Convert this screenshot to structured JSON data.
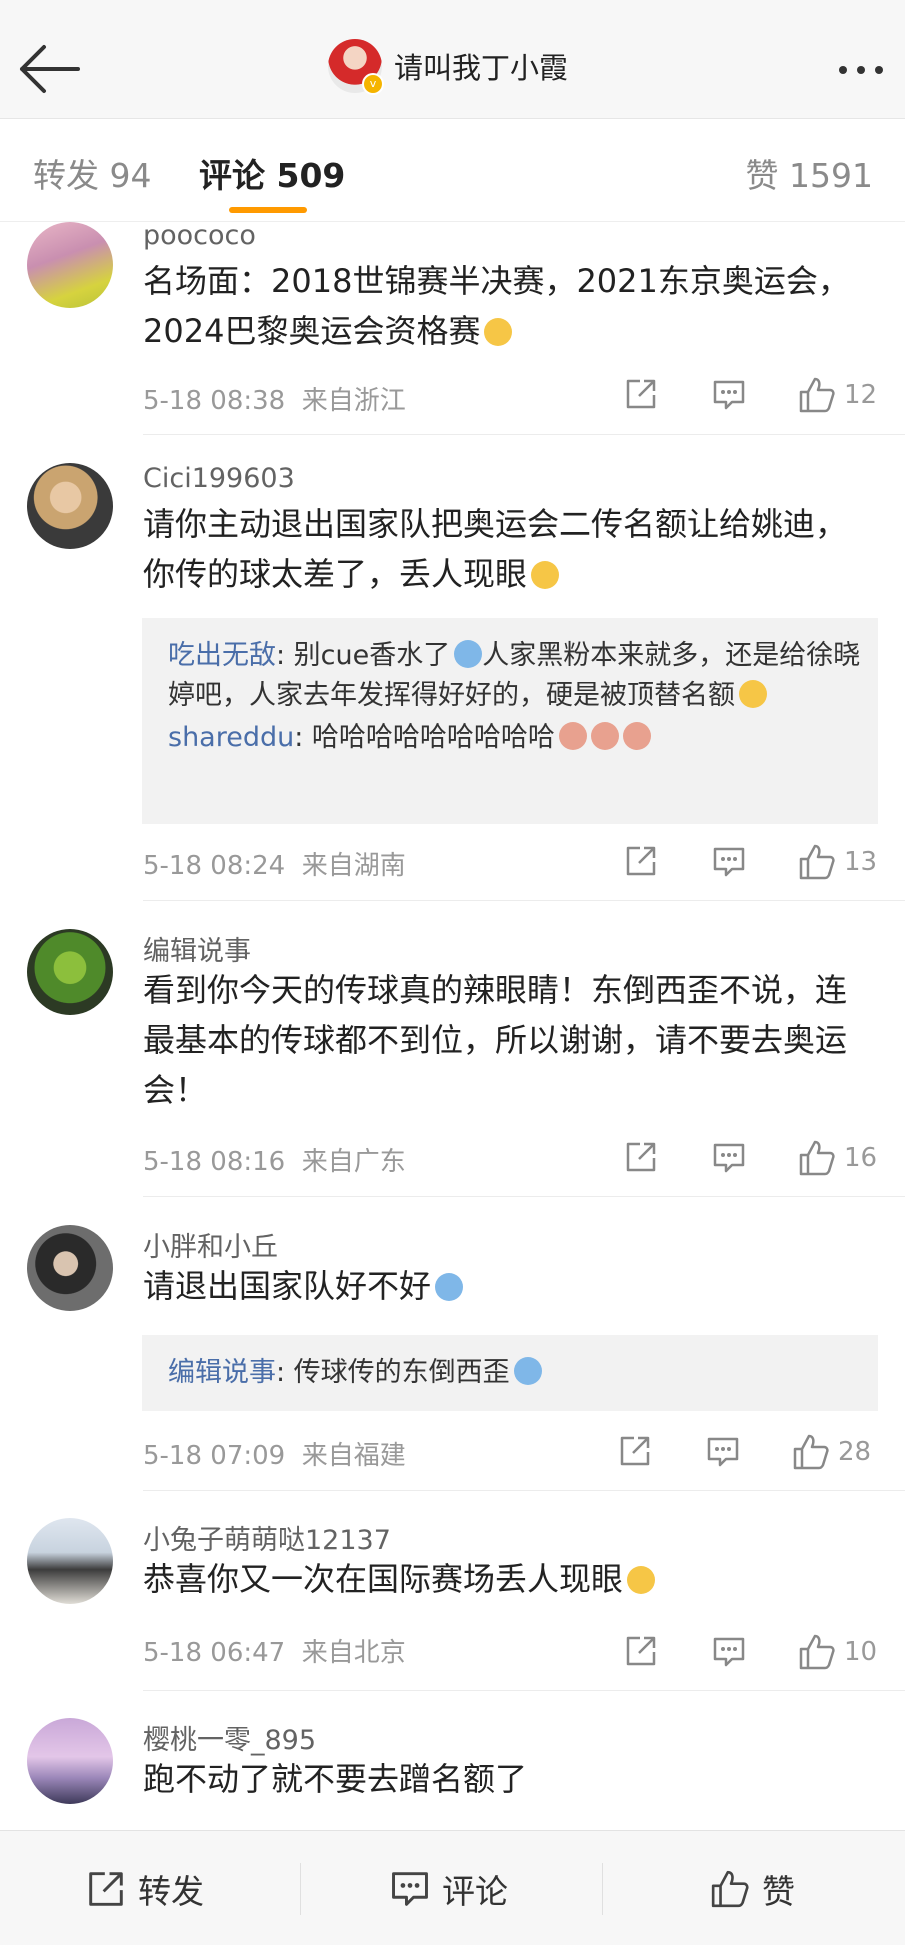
{
  "header": {
    "title": "请叫我丁小霞"
  },
  "tabs": {
    "repost": "转发 94",
    "comment": "评论 509",
    "like": "赞 1591"
  },
  "comments": [
    {
      "user": "poococo",
      "text": "名场面：2018世锦赛半决赛，2021东京奥运会，2024巴黎奥运会资格赛",
      "time": "5-18 08:38",
      "location": "来自浙江",
      "likes": "12"
    },
    {
      "user": "Cici199603",
      "text": "请你主动退出国家队把奥运会二传名额让给姚迪，你传的球太差了，丢人现眼",
      "replies": [
        {
          "user": "吃出无敌",
          "text": ": 别cue香水了",
          "text2": "人家黑粉本来就多，还是给徐晓婷吧，人家去年发挥得好好的，硬是被顶替名额"
        },
        {
          "user": "shareddu",
          "text": ": 哈哈哈哈哈哈哈哈哈"
        }
      ],
      "time": "5-18 08:24",
      "location": "来自湖南",
      "likes": "13"
    },
    {
      "user": "编辑说事",
      "text": "看到你今天的传球真的辣眼睛！东倒西歪不说，连最基本的传球都不到位，所以谢谢，请不要去奥运会！",
      "time": "5-18 08:16",
      "location": "来自广东",
      "likes": "16"
    },
    {
      "user": "小胖和小丘",
      "text": "请退出国家队好不好",
      "replies": [
        {
          "user": "编辑说事",
          "text": ": 传球传的东倒西歪"
        }
      ],
      "time": "5-18 07:09",
      "location": "来自福建",
      "likes": "28"
    },
    {
      "user": "小兔子萌萌哒12137",
      "text": "恭喜你又一次在国际赛场丢人现眼",
      "time": "5-18 06:47",
      "location": "来自北京",
      "likes": "10"
    },
    {
      "user": "樱桃一零_895",
      "text": "跑不动了就不要去蹭名额了"
    }
  ],
  "bottom": {
    "repost": "转发",
    "comment": "评论",
    "like": "赞"
  },
  "colors": {
    "accent": "#ff9a00",
    "reply_name": "#4a6ea9",
    "meta": "#999999"
  },
  "icons": [
    "back-arrow-icon",
    "more-icon",
    "share-icon",
    "comment-icon",
    "like-icon",
    "verified-icon"
  ]
}
